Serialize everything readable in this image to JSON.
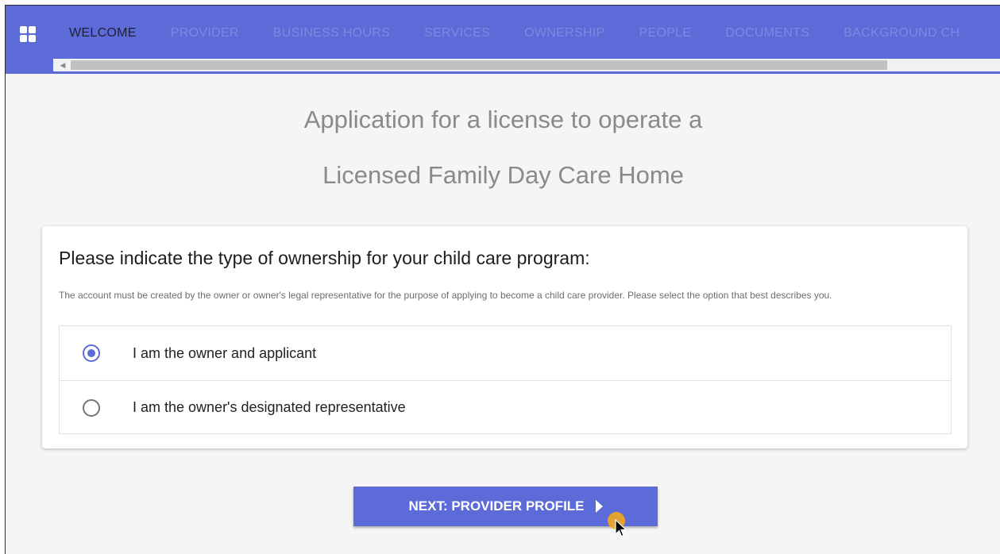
{
  "topbar": {
    "tabs": [
      {
        "label": "WELCOME",
        "active": true
      },
      {
        "label": "PROVIDER",
        "active": false
      },
      {
        "label": "BUSINESS HOURS",
        "active": false
      },
      {
        "label": "SERVICES",
        "active": false
      },
      {
        "label": "OWNERSHIP",
        "active": false
      },
      {
        "label": "PEOPLE",
        "active": false
      },
      {
        "label": "DOCUMENTS",
        "active": false
      },
      {
        "label": "BACKGROUND CH",
        "active": false
      }
    ],
    "scroll_arrow": "◀"
  },
  "page": {
    "title_line1": "Application for a license to operate a",
    "title_line2": "Licensed Family Day Care Home"
  },
  "card": {
    "heading": "Please indicate the type of ownership for your child care program:",
    "description": "The account must be created by the owner or owner's legal representative for the purpose of applying to become a child care provider. Please select the option that best describes you.",
    "options": [
      {
        "label": "I am the owner and applicant",
        "selected": true
      },
      {
        "label": "I am the owner's designated representative",
        "selected": false
      }
    ]
  },
  "next_button": {
    "label": "NEXT: PROVIDER PROFILE"
  },
  "colors": {
    "accent": "#5c6bd7",
    "tab_inactive": "#7d89e2",
    "title_gray": "#8a8a8a",
    "cursor_highlight": "#f2a81d"
  },
  "icons": [
    "apps-grid-icon",
    "scroll-left-arrow-icon",
    "caret-right-icon",
    "mouse-cursor-icon"
  ]
}
